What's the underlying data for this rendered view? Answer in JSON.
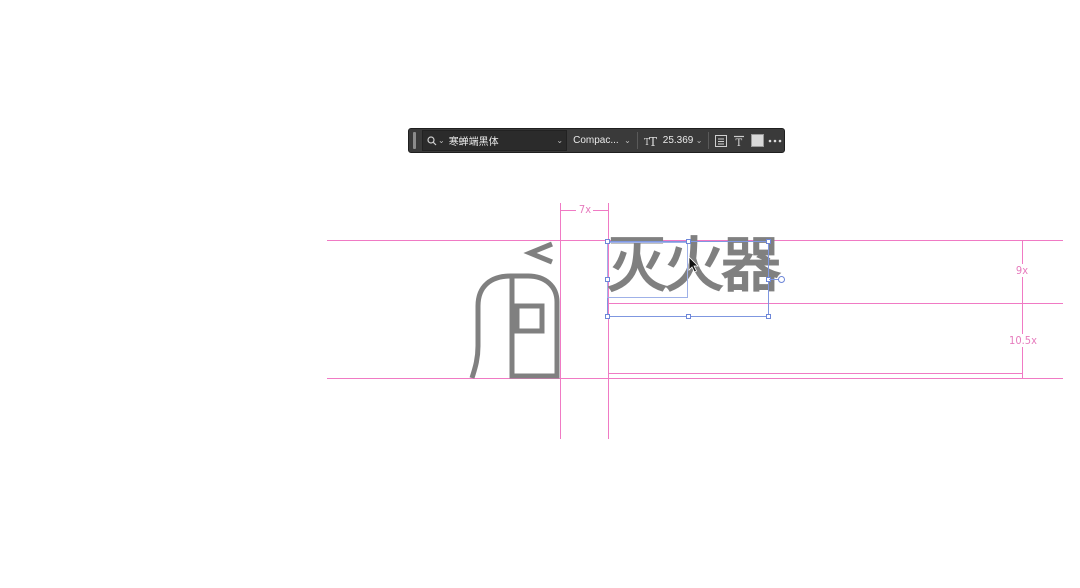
{
  "toolbar": {
    "font_family": "寒蝉端黑体",
    "font_style": "Compac...",
    "font_size": "25.369",
    "icons": [
      "search-icon",
      "chevron-down-icon",
      "font-size-icon",
      "align-text-icon",
      "warp-text-icon",
      "color-swatch-icon",
      "more-icon"
    ],
    "swatch_color": "#d9d9d9"
  },
  "canvas": {
    "text_layer": "灭火器",
    "text_color": "#808080",
    "guide_color": "#f07ac4",
    "selection_color": "#7f97e0",
    "measurements": {
      "gap": "7x",
      "cap_height": "9x",
      "descent": "10.5x"
    }
  }
}
